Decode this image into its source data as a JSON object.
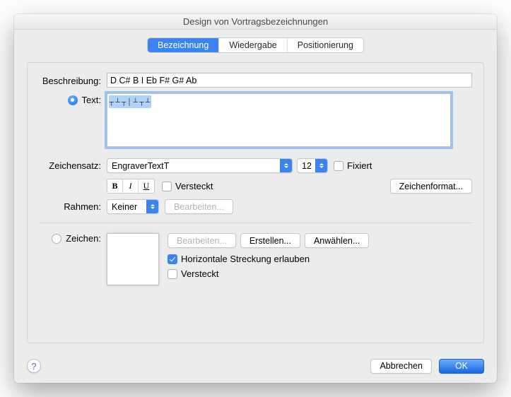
{
  "title": "Design von Vortragsbezeichnungen",
  "tabs": {
    "bezeichnung": "Bezeichnung",
    "wiedergabe": "Wiedergabe",
    "positionierung": "Positionierung"
  },
  "labels": {
    "beschreibung": "Beschreibung:",
    "text": "Text:",
    "zeichensatz": "Zeichensatz:",
    "rahmen": "Rahmen:",
    "zeichen": "Zeichen:"
  },
  "beschreibung_value": "D C# B I Eb F# G# Ab",
  "font": {
    "name": "EngraverTextT",
    "size": "12"
  },
  "fixiert_label": "Fixiert",
  "versteckt_label": "Versteckt",
  "zeichenformat_btn": "Zeichenformat...",
  "rahmen_value": "Keiner",
  "bearbeiten_btn": "Bearbeiten...",
  "erstellen_btn": "Erstellen...",
  "anwaehlen_btn": "Anwählen...",
  "horiz_streckung_label": "Horizontale Streckung erlauben",
  "footer": {
    "abbrechen": "Abbrechen",
    "ok": "OK"
  }
}
